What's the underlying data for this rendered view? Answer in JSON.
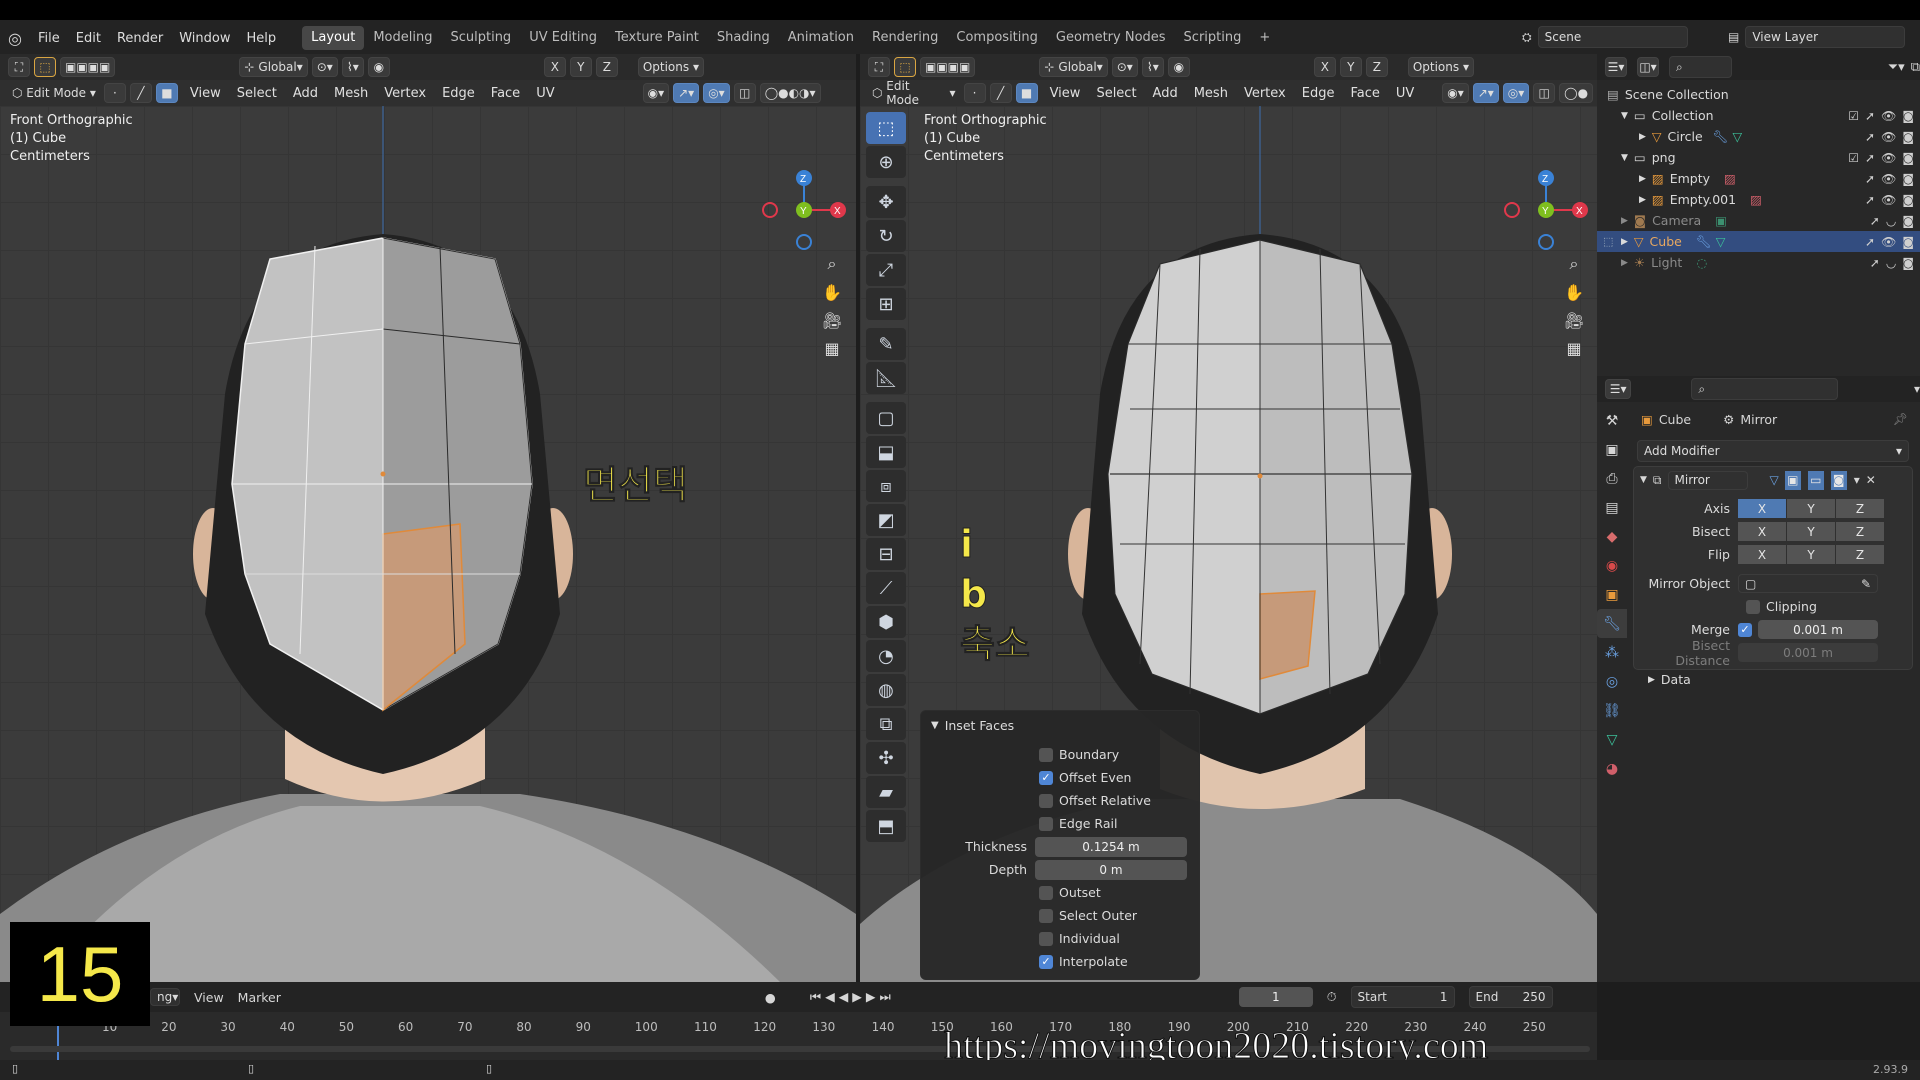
{
  "topbar": {
    "menus": [
      "File",
      "Edit",
      "Render",
      "Window",
      "Help"
    ],
    "workspace_tabs": [
      "Layout",
      "Modeling",
      "Sculpting",
      "UV Editing",
      "Texture Paint",
      "Shading",
      "Animation",
      "Rendering",
      "Compositing",
      "Geometry Nodes",
      "Scripting"
    ],
    "active_tab": "Layout",
    "add_tab": "+",
    "scene": "Scene",
    "view_layer": "View Layer"
  },
  "left_viewport": {
    "transform_orientation": "Global",
    "axes": [
      "X",
      "Y",
      "Z"
    ],
    "options": "Options",
    "mode": "Edit Mode",
    "menus": [
      "View",
      "Select",
      "Add",
      "Mesh",
      "Vertex",
      "Edge",
      "Face",
      "UV"
    ],
    "overlay_lines": [
      "Front Orthographic",
      "(1) Cube",
      "Centimeters"
    ],
    "annotation": "면선택",
    "gizmo_labels": {
      "z": "Z",
      "y": "Y",
      "x": "X"
    }
  },
  "right_viewport": {
    "transform_orientation": "Global",
    "axes": [
      "X",
      "Y",
      "Z"
    ],
    "options": "Options",
    "mode": "Edit Mode",
    "menus": [
      "View",
      "Select",
      "Add",
      "Mesh",
      "Vertex",
      "Edge",
      "Face",
      "UV"
    ],
    "overlay_lines": [
      "Front Orthographic",
      "(1) Cube",
      "Centimeters"
    ],
    "annotations": [
      "i",
      "b",
      "축소"
    ],
    "gizmo_labels": {
      "z": "Z",
      "y": "Y",
      "x": "X"
    }
  },
  "inset_panel": {
    "title": "Inset Faces",
    "options": [
      {
        "label": "Boundary",
        "checked": false
      },
      {
        "label": "Offset Even",
        "checked": true
      },
      {
        "label": "Offset Relative",
        "checked": false
      },
      {
        "label": "Edge Rail",
        "checked": false
      }
    ],
    "thickness_label": "Thickness",
    "thickness_value": "0.1254 m",
    "depth_label": "Depth",
    "depth_value": "0 m",
    "options2": [
      {
        "label": "Outset",
        "checked": false
      },
      {
        "label": "Select Outer",
        "checked": false
      },
      {
        "label": "Individual",
        "checked": false
      },
      {
        "label": "Interpolate",
        "checked": true
      }
    ]
  },
  "outliner": {
    "items": [
      {
        "label": "Scene Collection",
        "depth": 0
      },
      {
        "label": "Collection",
        "depth": 1
      },
      {
        "label": "Circle",
        "depth": 2
      },
      {
        "label": "png",
        "depth": 1
      },
      {
        "label": "Empty",
        "depth": 2
      },
      {
        "label": "Empty.001",
        "depth": 2
      },
      {
        "label": "Camera",
        "depth": 1
      },
      {
        "label": "Cube",
        "depth": 1,
        "selected": true
      },
      {
        "label": "Light",
        "depth": 1
      }
    ]
  },
  "properties": {
    "object": "Cube",
    "modifier_crumb": "Mirror",
    "add_modifier": "Add Modifier",
    "modifier_name": "Mirror",
    "axis_label": "Axis",
    "bisect_label": "Bisect",
    "flip_label": "Flip",
    "xyz": [
      "X",
      "Y",
      "Z"
    ],
    "mirror_object_label": "Mirror Object",
    "clipping_label": "Clipping",
    "merge_label": "Merge",
    "merge_value": "0.001 m",
    "bisect_distance_label": "Bisect Distance",
    "bisect_distance_value": "0.001 m",
    "data_label": "Data"
  },
  "timeline": {
    "playback_partial": "ng",
    "view": "View",
    "marker": "Marker",
    "current_frame": "1",
    "start_label": "Start",
    "start_value": "1",
    "end_label": "End",
    "end_value": "250",
    "ruler": [
      "10",
      "20",
      "30",
      "40",
      "50",
      "60",
      "70",
      "80",
      "90",
      "100",
      "110",
      "120",
      "130",
      "140",
      "150",
      "160",
      "170",
      "180",
      "190",
      "200",
      "210",
      "220",
      "230",
      "240",
      "250"
    ]
  },
  "episode_number": "15",
  "watermark": "https://movingtoon2020.tistory.com",
  "version": "2.93.9",
  "colors": {
    "accent": "#4772b3",
    "selected_face": "#e0a070",
    "annotation_yellow": "#f5e84a",
    "gizmo_x": "#e0384b",
    "gizmo_y": "#7fbf1f",
    "gizmo_z": "#3a82d6"
  }
}
